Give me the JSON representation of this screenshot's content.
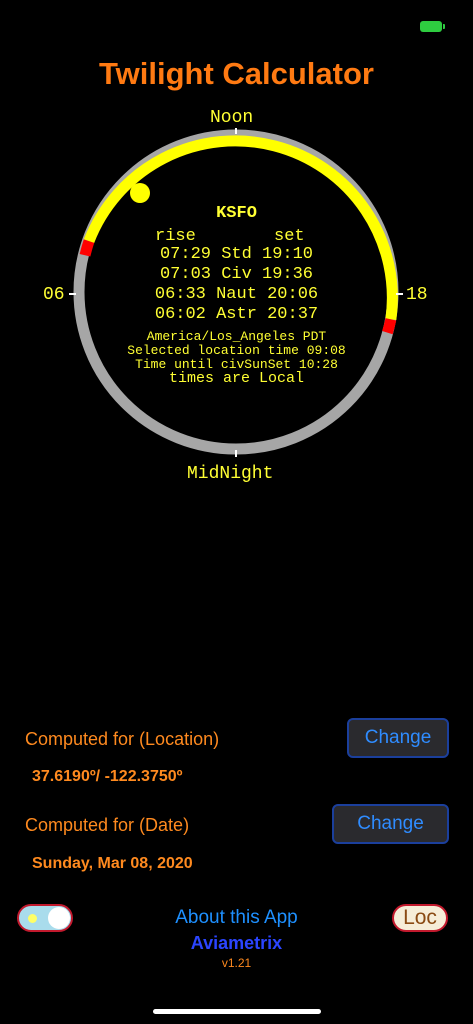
{
  "app_title": "Twilight Calculator",
  "colors": {
    "accent": "#ff7a12",
    "daylight_arc": "#ffff00",
    "night_arc": "#a6a6a6",
    "twilight_marker": "#ff0000",
    "button_text": "#2f8cff"
  },
  "dial": {
    "top_label": "Noon",
    "bottom_label": "MidNight",
    "left_label": "06",
    "right_label": "18",
    "station": "KSFO",
    "col_rise": "rise",
    "col_set": "set",
    "rows": [
      "07:29 Std 19:10",
      "07:03 Civ 19:36",
      "06:33 Naut 20:06",
      "06:02 Astr 20:37"
    ],
    "timezone": "America/Los_Angeles PDT",
    "selected_time": "Selected location time 09:08",
    "time_until": "Time until civSunSet 10:28",
    "times_note": "times are Local"
  },
  "location": {
    "label": "Computed for (Location)",
    "value": "37.6190º/ -122.3750º",
    "change_label": "Change"
  },
  "date": {
    "label": "Computed for (Date)",
    "value": "Sunday, Mar 08, 2020",
    "change_label": "Change"
  },
  "footer": {
    "about_label": "About this App",
    "brand": "Aviametrix",
    "version": "v1.21",
    "loc_label": "Loc"
  },
  "icons": {
    "battery": "battery-charging-icon",
    "sun": "sun-position-icon"
  }
}
